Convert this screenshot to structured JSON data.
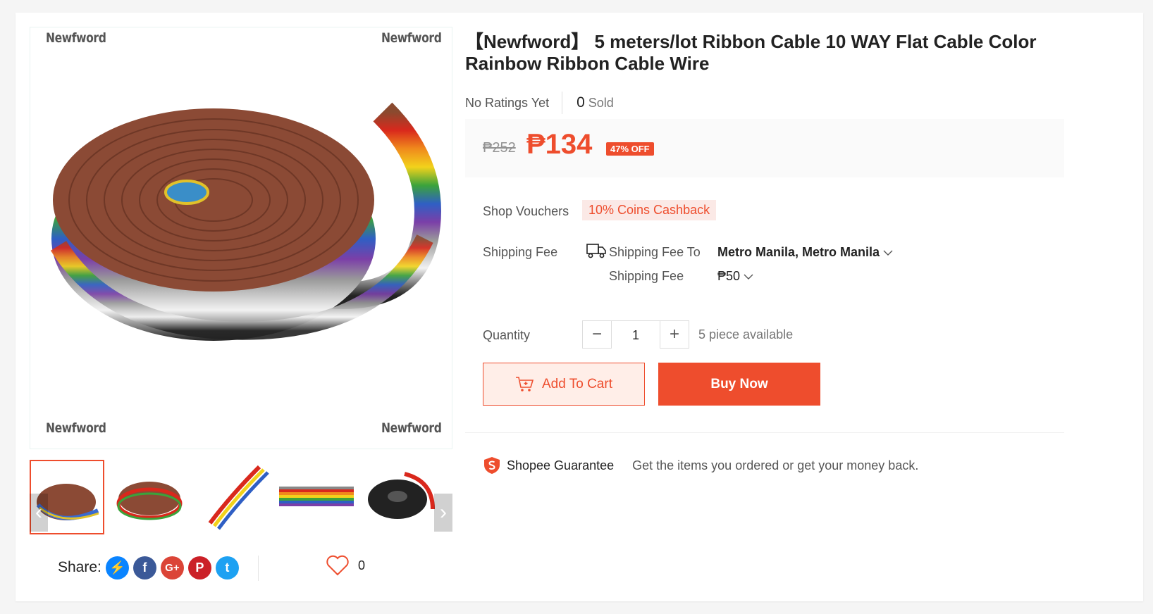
{
  "product": {
    "title": "【Newfword】 5 meters/lot Ribbon Cable 10 WAY Flat Cable Color Rainbow Ribbon Cable Wire",
    "ratings_text": "No Ratings Yet",
    "sold_count": "0",
    "sold_label": "Sold"
  },
  "gallery": {
    "watermark": "Newfword",
    "thumbnail_count": 5,
    "active_thumbnail": 0
  },
  "price": {
    "original": "₱252",
    "current": "₱134",
    "discount_badge": "47% OFF"
  },
  "vouchers": {
    "label": "Shop Vouchers",
    "tag": "10% Coins Cashback"
  },
  "shipping": {
    "label": "Shipping Fee",
    "to_label": "Shipping Fee To",
    "to_value": "Metro Manila, Metro Manila",
    "fee_label": "Shipping Fee",
    "fee_value": "₱50"
  },
  "quantity": {
    "label": "Quantity",
    "value": "1",
    "available": "5 piece available"
  },
  "actions": {
    "add_to_cart": "Add To Cart",
    "buy_now": "Buy Now"
  },
  "guarantee": {
    "title": "Shopee Guarantee",
    "text": "Get the items you ordered or get your money back."
  },
  "share": {
    "label": "Share:",
    "networks": [
      "messenger-icon",
      "facebook-icon",
      "google-plus-icon",
      "pinterest-icon",
      "twitter-icon"
    ]
  },
  "likes": {
    "count": "0"
  },
  "colors": {
    "accent": "#ee4d2d",
    "price_bg": "#fafafa",
    "cart_bg": "#ffeee8"
  }
}
